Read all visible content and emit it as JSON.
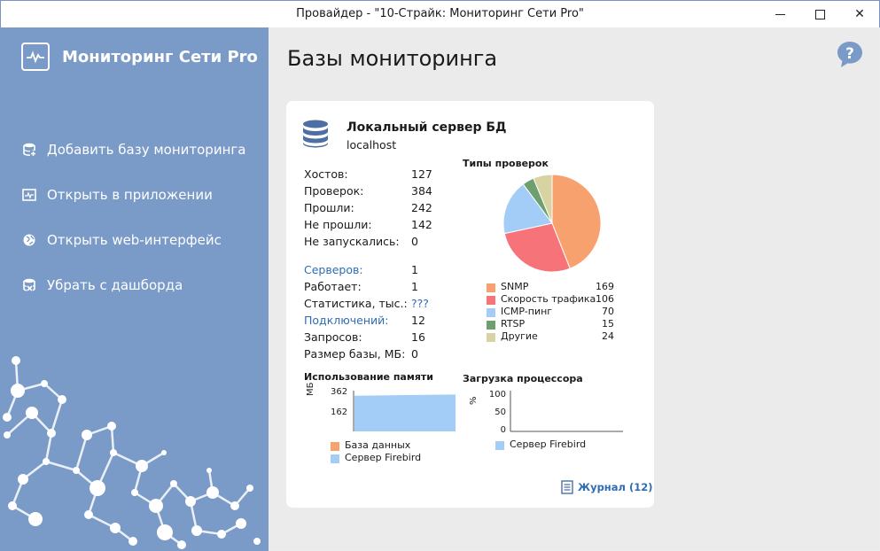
{
  "window": {
    "title": "Провайдер - \"10-Страйк: Мониторинг Сети Pro\"",
    "controls": {
      "minimize": "minimize-icon",
      "maximize": "maximize-icon",
      "close": "✕"
    }
  },
  "sidebar": {
    "brand": "Мониторинг Сети Pro",
    "items": [
      {
        "label": "Добавить базу мониторинга",
        "icon": "database-add-icon"
      },
      {
        "label": "Открыть в приложении",
        "icon": "monitor-chart-icon"
      },
      {
        "label": "Открыть web-интерфейс",
        "icon": "globe-icon"
      },
      {
        "label": "Убрать с дашборда",
        "icon": "database-remove-icon"
      }
    ]
  },
  "main": {
    "title": "Базы мониторинга",
    "help_icon": "help-icon"
  },
  "card": {
    "title": "Локальный сервер БД",
    "subtitle": "localhost",
    "stats_group1": [
      {
        "label": "Хостов:",
        "value": "127"
      },
      {
        "label": "Проверок:",
        "value": "384"
      },
      {
        "label": "Прошли:",
        "value": "242"
      },
      {
        "label": "Не прошли:",
        "value": "142"
      },
      {
        "label": "Не запускались:",
        "value": "0"
      }
    ],
    "stats_group2": [
      {
        "label": "Серверов:",
        "value": "1",
        "link": true
      },
      {
        "label": "Работает:",
        "value": "1",
        "link": false
      },
      {
        "label": "Статистика, тыс.:",
        "value": "???",
        "link": false,
        "value_link": true
      },
      {
        "label": "Подключений:",
        "value": "12",
        "link": true
      },
      {
        "label": "Запросов:",
        "value": "16",
        "link": false
      },
      {
        "label": "Размер базы, МБ:",
        "value": "0",
        "link": false
      }
    ],
    "journal": "Журнал (12)"
  },
  "chart_data": [
    {
      "type": "pie",
      "title": "Типы проверок",
      "categories": [
        "SNMP",
        "Скорость трафика",
        "ICMP-пинг",
        "RTSP",
        "Другие"
      ],
      "values": [
        169,
        106,
        70,
        15,
        24
      ],
      "colors": [
        "#f7a16f",
        "#f7737a",
        "#a3cdf7",
        "#6f9f6f",
        "#d7d3a3"
      ]
    },
    {
      "type": "area",
      "title": "Использование памяти",
      "ylabel": "МБ",
      "yticks": [
        "362",
        "162"
      ],
      "series": [
        {
          "name": "База данных",
          "color": "#f7a16f",
          "values": [
            0,
            0
          ]
        },
        {
          "name": "Сервер Firebird",
          "color": "#a3cdf7",
          "values": [
            350,
            362
          ]
        }
      ]
    },
    {
      "type": "line",
      "title": "Загрузка процессора",
      "ylabel": "%",
      "ylim": [
        0,
        100
      ],
      "yticks": [
        "100",
        "50",
        "0"
      ],
      "series": [
        {
          "name": "Сервер Firebird",
          "color": "#a3cdf7",
          "values": []
        }
      ]
    }
  ]
}
